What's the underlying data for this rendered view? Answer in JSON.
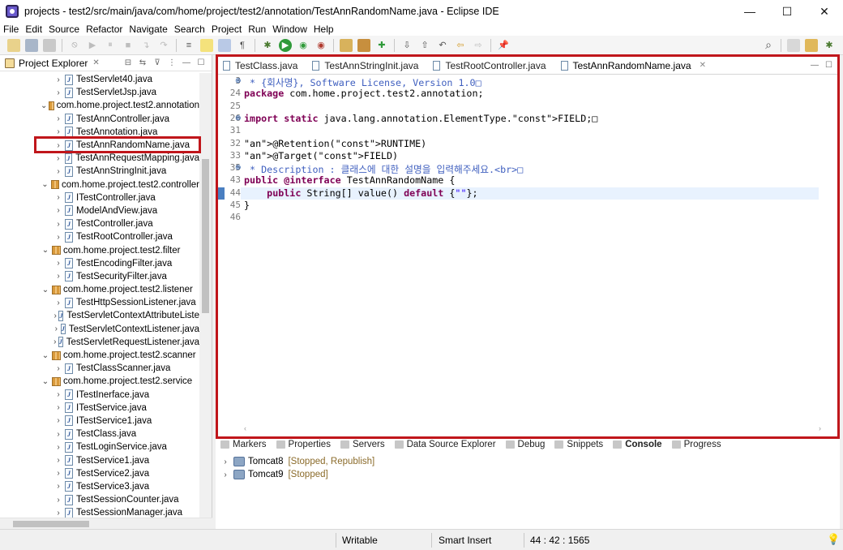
{
  "window": {
    "title": "projects - test2/src/main/java/com/home/project/test2/annotation/TestAnnRandomName.java - Eclipse IDE",
    "controls": [
      "—",
      "☐",
      "✕"
    ]
  },
  "menu": [
    "File",
    "Edit",
    "Source",
    "Refactor",
    "Navigate",
    "Search",
    "Project",
    "Run",
    "Window",
    "Help"
  ],
  "explorer": {
    "tab_label": "Project Explorer",
    "selected": "TestAnnRandomName.java",
    "tree": [
      {
        "type": "file",
        "label": "TestServlet40.java",
        "expanded": false
      },
      {
        "type": "file",
        "label": "TestServletJsp.java",
        "expanded": false
      },
      {
        "type": "package",
        "label": "com.home.project.test2.annotation",
        "expanded": true
      },
      {
        "type": "file",
        "label": "TestAnnController.java",
        "expanded": false
      },
      {
        "type": "file",
        "label": "TestAnnotation.java",
        "expanded": false
      },
      {
        "type": "file",
        "label": "TestAnnRandomName.java",
        "expanded": false
      },
      {
        "type": "file",
        "label": "TestAnnRequestMapping.java",
        "expanded": false
      },
      {
        "type": "file",
        "label": "TestAnnStringInit.java",
        "expanded": false
      },
      {
        "type": "package",
        "label": "com.home.project.test2.controller",
        "expanded": true
      },
      {
        "type": "file",
        "label": "ITestController.java",
        "expanded": false
      },
      {
        "type": "file",
        "label": "ModelAndView.java",
        "expanded": false
      },
      {
        "type": "file",
        "label": "TestController.java",
        "expanded": false
      },
      {
        "type": "file",
        "label": "TestRootController.java",
        "expanded": false
      },
      {
        "type": "package",
        "label": "com.home.project.test2.filter",
        "expanded": true
      },
      {
        "type": "file",
        "label": "TestEncodingFilter.java",
        "expanded": false
      },
      {
        "type": "file",
        "label": "TestSecurityFilter.java",
        "expanded": false
      },
      {
        "type": "package",
        "label": "com.home.project.test2.listener",
        "expanded": true
      },
      {
        "type": "file",
        "label": "TestHttpSessionListener.java",
        "expanded": false
      },
      {
        "type": "file",
        "label": "TestServletContextAttributeListe",
        "expanded": false
      },
      {
        "type": "file",
        "label": "TestServletContextListener.java",
        "expanded": false
      },
      {
        "type": "file",
        "label": "TestServletRequestListener.java",
        "expanded": false
      },
      {
        "type": "package",
        "label": "com.home.project.test2.scanner",
        "expanded": true
      },
      {
        "type": "file",
        "label": "TestClassScanner.java",
        "expanded": false
      },
      {
        "type": "package",
        "label": "com.home.project.test2.service",
        "expanded": true
      },
      {
        "type": "file",
        "label": "ITestInerface.java",
        "expanded": false
      },
      {
        "type": "file",
        "label": "ITestService.java",
        "expanded": false
      },
      {
        "type": "file",
        "label": "ITestService1.java",
        "expanded": false
      },
      {
        "type": "file",
        "label": "TestClass.java",
        "expanded": false
      },
      {
        "type": "file",
        "label": "TestLoginService.java",
        "expanded": false
      },
      {
        "type": "file",
        "label": "TestService1.java",
        "expanded": false
      },
      {
        "type": "file",
        "label": "TestService2.java",
        "expanded": false
      },
      {
        "type": "file",
        "label": "TestService3.java",
        "expanded": false
      },
      {
        "type": "file",
        "label": "TestSessionCounter.java",
        "expanded": false
      },
      {
        "type": "file",
        "label": "TestSessionManager.java",
        "expanded": false
      }
    ]
  },
  "editor": {
    "tabs": [
      {
        "label": "TestClass.java",
        "active": false
      },
      {
        "label": "TestAnnStringInit.java",
        "active": false
      },
      {
        "label": "TestRootController.java",
        "active": false
      },
      {
        "label": "TestAnnRandomName.java",
        "active": true
      }
    ],
    "lines": [
      {
        "num": "3",
        "fold": "⊕",
        "text": " * {회사명}, Software License, Version 1.0□"
      },
      {
        "num": "24",
        "fold": "",
        "text": "package com.home.project.test2.annotation;"
      },
      {
        "num": "25",
        "fold": "",
        "text": ""
      },
      {
        "num": "26",
        "fold": "⊕",
        "text": "import static java.lang.annotation.ElementType.FIELD;□"
      },
      {
        "num": "31",
        "fold": "",
        "text": ""
      },
      {
        "num": "32",
        "fold": "",
        "text": "@Retention(RUNTIME)"
      },
      {
        "num": "33",
        "fold": "",
        "text": "@Target(FIELD)"
      },
      {
        "num": "35",
        "fold": "⊕",
        "text": " * Description : 클래스에 대한 설명을 입력해주세요.<br>□"
      },
      {
        "num": "43",
        "fold": "",
        "text": "public @interface TestAnnRandomName {"
      },
      {
        "num": "44",
        "fold": "",
        "text": "    public String[] value() default {\"\"};"
      },
      {
        "num": "45",
        "fold": "",
        "text": "}"
      },
      {
        "num": "46",
        "fold": "",
        "text": ""
      }
    ]
  },
  "bottom_panel": {
    "tabs": [
      "Markers",
      "Properties",
      "Servers",
      "Data Source Explorer",
      "Debug",
      "Snippets",
      "Console",
      "Progress"
    ],
    "active_tab": "Console",
    "servers": [
      {
        "name": "Tomcat8",
        "status": "[Stopped, Republish]"
      },
      {
        "name": "Tomcat9",
        "status": "[Stopped]"
      }
    ]
  },
  "statusbar": {
    "mode": "Writable",
    "insert": "Smart Insert",
    "position": "44 : 42 : 1565"
  }
}
